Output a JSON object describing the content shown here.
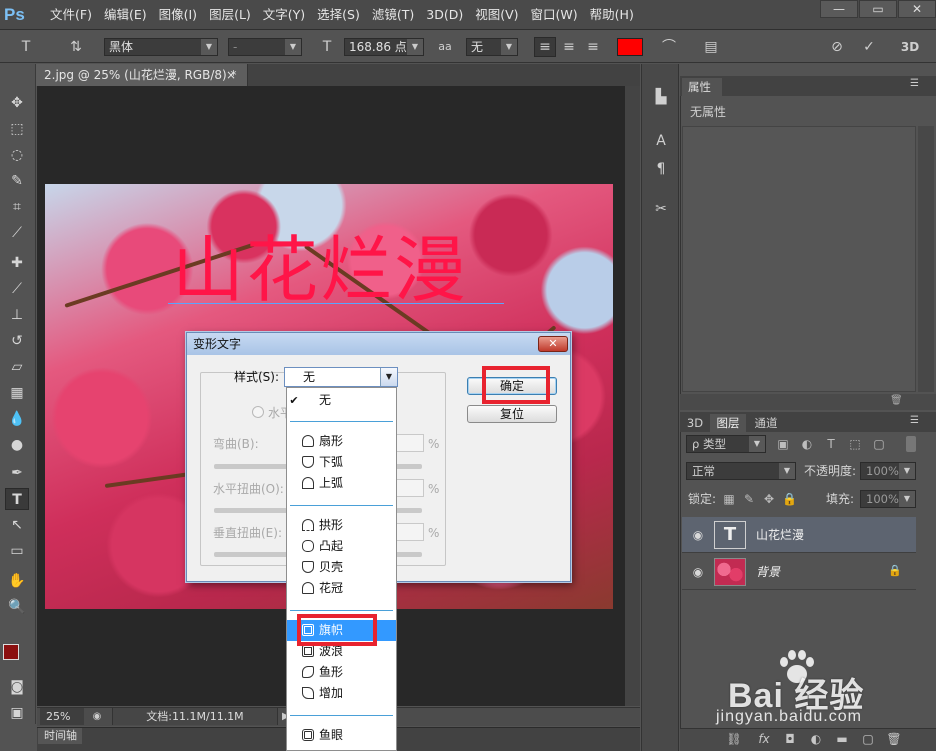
{
  "app": {
    "logo": "Ps"
  },
  "menu": [
    "文件(F)",
    "编辑(E)",
    "图像(I)",
    "图层(L)",
    "文字(Y)",
    "选择(S)",
    "滤镜(T)",
    "3D(D)",
    "视图(V)",
    "窗口(W)",
    "帮助(H)"
  ],
  "window_controls": [
    "—",
    "▭",
    "✕"
  ],
  "options_bar": {
    "font_family": "黑体",
    "font_style": "-",
    "font_size": "168.86 点",
    "aa_label": "aa",
    "antialias": "无",
    "text_color": "#ff0000"
  },
  "document": {
    "tab_title": "2.jpg @ 25% (山花烂漫, RGB/8) *",
    "canvas_text": "山花烂漫",
    "canvas_text_color": "#ff1548",
    "zoom": "25%",
    "doc_size": "文档:11.1M/11.1M"
  },
  "timeline_tab": "时间轴",
  "properties": {
    "tab": "属性",
    "content": "无属性"
  },
  "layers": {
    "tabs": [
      "3D",
      "图层",
      "通道"
    ],
    "filter_kind": "ρ 类型",
    "blend_mode": "正常",
    "opacity_label": "不透明度:",
    "opacity": "100%",
    "lock_label": "锁定:",
    "fill_label": "填充:",
    "fill": "100%",
    "items": [
      {
        "name": "山花烂漫",
        "type": "text",
        "selected": true
      },
      {
        "name": "背景",
        "type": "image",
        "selected": false
      }
    ]
  },
  "warp_dialog": {
    "title": "变形文字",
    "style_label": "样式(S):",
    "style_value": "无",
    "orientation_horizontal": "水平",
    "bend_label": "弯曲(B):",
    "h_distort_label": "水平扭曲(O):",
    "v_distort_label": "垂直扭曲(E):",
    "percent": "%",
    "ok": "确定",
    "reset": "复位"
  },
  "style_options": [
    "无",
    "扇形",
    "下弧",
    "上弧",
    "拱形",
    "凸起",
    "贝壳",
    "花冠",
    "旗帜",
    "波浪",
    "鱼形",
    "增加",
    "鱼眼"
  ],
  "style_selected_check": "✔",
  "highlighted_style": "旗帜",
  "watermark": {
    "logo": "Bai  经验",
    "url": "jingyan.baidu.com"
  }
}
